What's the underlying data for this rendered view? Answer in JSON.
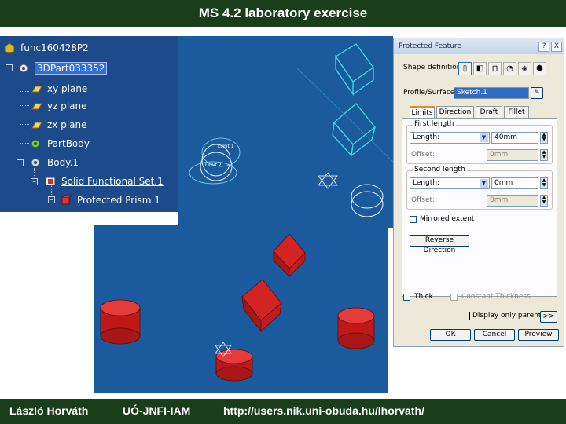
{
  "slide": {
    "title": "MS 4.2 laboratory exercise",
    "footer": {
      "author": "László Horváth",
      "institute": "UÓ-JNFI-IAM",
      "url": "http://users.nik.uni-obuda.hu/lhorvath/"
    }
  },
  "tree": {
    "root": "func160428P2",
    "part": "3DPart033352",
    "items": [
      {
        "label": "xy plane",
        "icon": "plane-icon"
      },
      {
        "label": "yz plane",
        "icon": "plane-icon"
      },
      {
        "label": "zx plane",
        "icon": "plane-icon"
      },
      {
        "label": "PartBody",
        "icon": "gear-icon"
      },
      {
        "label": "Body.1",
        "icon": "gear-icon"
      },
      {
        "label": "Solid Functional Set.1",
        "icon": "functional-set-icon"
      },
      {
        "label": "Protected Prism.1",
        "icon": "prism-icon"
      }
    ]
  },
  "viewport": {
    "sketch_labels": [
      "Limit 1",
      "Limit 2"
    ]
  },
  "dialog": {
    "title": "Protected Feature",
    "help_btn": "?",
    "close_btn": "X",
    "shape_definition_label": "Shape definition",
    "profile_label": "Profile/Surface:",
    "profile_value": "Sketch.1",
    "tabs": [
      "Limits",
      "Direction",
      "Draft",
      "Fillet"
    ],
    "first_length": {
      "group": "First length",
      "type_label": "Length:",
      "value": "40mm",
      "offset_label": "Offset:",
      "offset_value": "0mm"
    },
    "second_length": {
      "group": "Second length",
      "type_label": "Length:",
      "value": "0mm",
      "offset_label": "Offset:",
      "offset_value": "0mm"
    },
    "mirrored_extent": "Mirrored extent",
    "reverse_direction": "Reverse Direction",
    "thick": "Thick",
    "constant_thickness": "Constant Thickness",
    "display_parents": "Display only parents",
    "more": ">>",
    "ok": "OK",
    "cancel": "Cancel",
    "preview": "Preview"
  }
}
